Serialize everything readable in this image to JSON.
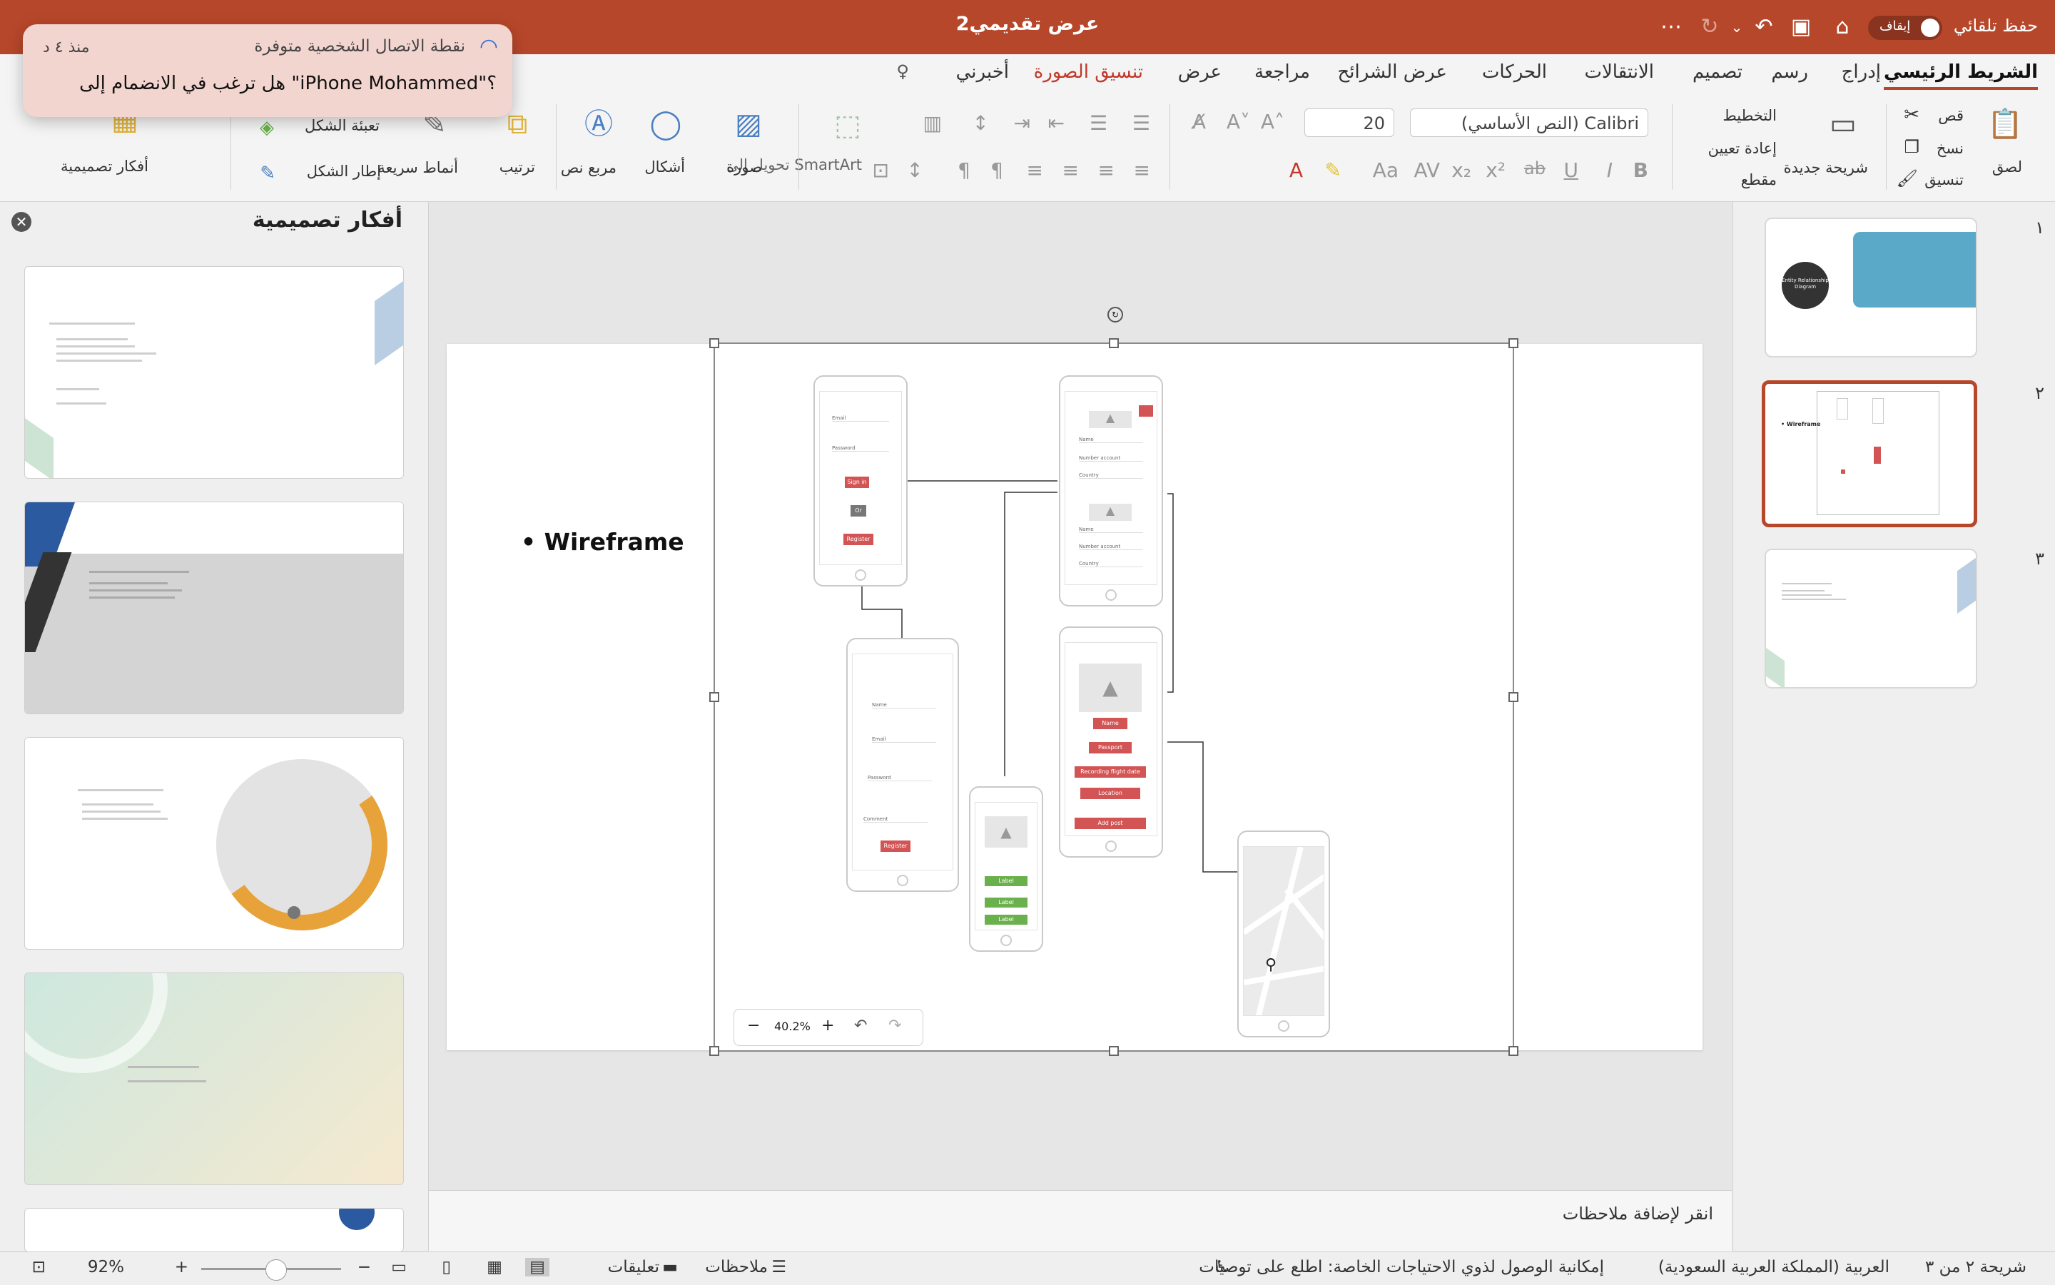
{
  "window": {
    "title": "عرض تقديمي2",
    "autosave_label": "حفظ تلقائي",
    "autosave_state": "إيقاف"
  },
  "notification": {
    "title": "نقطة الاتصال الشخصية متوفرة",
    "message": "هل ترغب في الانضمام إلى \"iPhone Mohammed\"؟",
    "time": "منذ ٤ د"
  },
  "tabs": [
    "الشريط الرئيسي",
    "إدراج",
    "رسم",
    "تصميم",
    "الانتقالات",
    "الحركات",
    "عرض الشرائح",
    "مراجعة",
    "عرض",
    "تنسيق الصورة",
    "أخبرني"
  ],
  "ribbon": {
    "paste": "لصق",
    "cut": "قص",
    "copy": "نسخ",
    "format": "تنسيق",
    "new_slide": "شريحة جديدة",
    "layout": "التخطيط",
    "reset": "إعادة تعيين",
    "section": "مقطع",
    "font_name": "(النص الأساسي) Calibri",
    "font_size": "20",
    "convert_smartart": "تحويل إلى SmartArt",
    "picture": "صورة",
    "shapes": "أشكال",
    "textbox": "مربع نص",
    "arrange": "ترتيب",
    "quick_styles": "أنماط سريعة",
    "shape_fill": "تعبئة الشكل",
    "shape_outline": "إطار الشكل",
    "design_ideas": "أفكار تصميمية"
  },
  "design_pane": {
    "title": "أفكار تصميمية"
  },
  "slide": {
    "bullet": "Wireframe",
    "zoom_value": "40.2%",
    "wireframe": {
      "login": {
        "email": "Email",
        "password": "Password",
        "signin": "Sign in",
        "or": "Or",
        "register": "Register"
      },
      "register": {
        "name": "Name",
        "email": "Email",
        "password": "Password",
        "confirm": "Comment",
        "register": "Register"
      },
      "profile": {
        "name": "Name",
        "number": "Number account",
        "country": "Country",
        "name2": "Name",
        "number2": "Number account",
        "country2": "Country"
      },
      "post": {
        "name": "Name",
        "passport": "Passport",
        "recording": "Recording flight date",
        "location": "Location",
        "add": "Add post"
      },
      "labels": {
        "l1": "Label",
        "l2": "Label",
        "l3": "Label"
      }
    }
  },
  "thumbs": {
    "n1": "١",
    "n2": "٢",
    "n3": "٣",
    "t1_circle": "Entity Relationship Diagram",
    "t2_bullet": "Wireframe"
  },
  "notes_placeholder": "انقر لإضافة ملاحظات",
  "status": {
    "slide_info": "شريحة ٢ من ٣",
    "language": "العربية (المملكة العربية السعودية)",
    "accessibility": "إمكانية الوصول لذوي الاحتياجات الخاصة: اطلع على توصيات",
    "notes": "ملاحظات",
    "comments": "تعليقات",
    "zoom": "92%"
  },
  "colors": {
    "accent": "#b7472a",
    "button_red": "#d35454",
    "button_green": "#6ab04c"
  }
}
